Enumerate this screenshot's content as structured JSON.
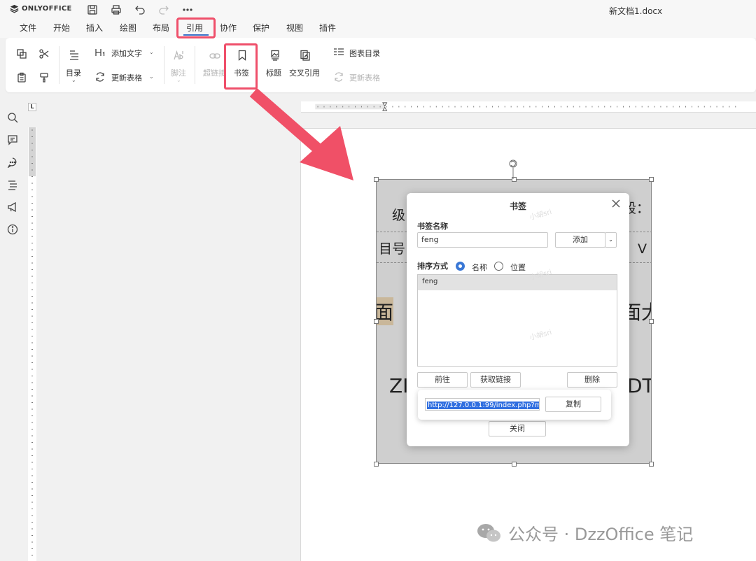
{
  "app": {
    "logo": "ONLYOFFICE",
    "doc_title": "新文档1.docx"
  },
  "quick_access": [
    "save-icon",
    "print-icon",
    "undo-icon",
    "redo-icon",
    "more-icon"
  ],
  "menu": {
    "tabs": [
      "文件",
      "开始",
      "插入",
      "绘图",
      "布局",
      "引用",
      "协作",
      "保护",
      "视图",
      "插件"
    ],
    "active": "引用"
  },
  "toolbar": {
    "toc": "目录",
    "add_text": "添加文字",
    "update_table": "更新表格",
    "footnote": "脚注",
    "hyperlink": "超链接",
    "bookmark": "书签",
    "caption": "标题",
    "cross_ref": "交叉引用",
    "table_of_figures": "图表目录",
    "update_table2": "更新表格"
  },
  "ruler": {
    "corner": "L"
  },
  "image_text": {
    "t1": "级",
    "t2": "段：",
    "t3": "目号",
    "t4": "：V",
    "t5": "面",
    "t6": "面大",
    "t7": "ZI",
    "t8": "DT"
  },
  "dialog": {
    "title": "书签",
    "name_label": "书签名称",
    "name_value": "feng",
    "add_button": "添加",
    "sort_label": "排序方式",
    "sort_name": "名称",
    "sort_position": "位置",
    "sort_selected": "名称",
    "list_items": [
      "feng"
    ],
    "goto_button": "前往",
    "get_link_button": "获取链接",
    "delete_button": "删除",
    "link_value": "http://127.0.0.1:99/index.php?m",
    "copy_button": "复制",
    "close_button": "关闭",
    "watermark": "小胡sri"
  },
  "footer": {
    "brand": "公众号 · DzzOffice 笔记"
  },
  "colors": {
    "highlight": "#ef4f6a",
    "accent": "#3a78d6"
  }
}
